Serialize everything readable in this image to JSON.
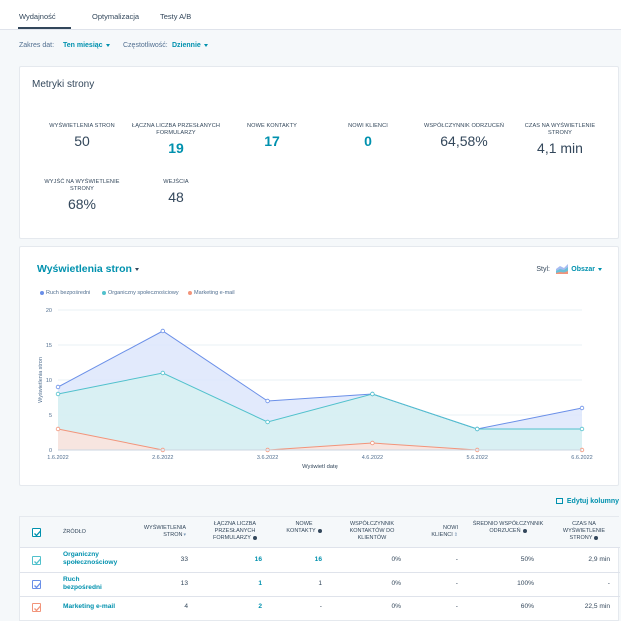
{
  "tabs": [
    {
      "label": "Wydajność",
      "active": true
    },
    {
      "label": "Optymalizacja",
      "active": false
    },
    {
      "label": "Testy A/B",
      "active": false
    }
  ],
  "filters": {
    "date_range_label": "Zakres dat:",
    "date_range_value": "Ten miesiąc",
    "frequency_label": "Częstotliwość:",
    "frequency_value": "Dziennie"
  },
  "metrics": {
    "title": "Metryki strony",
    "items": [
      {
        "label": "WYŚWIETLENIA STRON",
        "value": "50",
        "link": false
      },
      {
        "label": "ŁĄCZNA LICZBA PRZESŁANYCH FORMULARZY",
        "value": "19",
        "link": true
      },
      {
        "label": "NOWE KONTAKTY",
        "value": "17",
        "link": true
      },
      {
        "label": "NOWI KLIENCI",
        "value": "0",
        "link": true
      },
      {
        "label": "WSPÓŁCZYNNIK ODRZUCEŃ",
        "value": "64,58%",
        "link": false
      },
      {
        "label": "CZAS NA WYŚWIETLENIE STRONY",
        "value": "4,1 min",
        "link": false
      },
      {
        "label": "WYJŚĆ NA WYŚWIETLENIE STRONY",
        "value": "68%",
        "link": false
      },
      {
        "label": "WEJŚCIA",
        "value": "48",
        "link": false
      }
    ]
  },
  "chart_header": {
    "title": "Wyświetlenia stron",
    "style_label": "Styl:",
    "style_value": "Obszar"
  },
  "chart_data": {
    "type": "area",
    "x": [
      "1.6.2022",
      "2.6.2022",
      "3.6.2022",
      "4.6.2022",
      "5.6.2022",
      "6.6.2022"
    ],
    "series": [
      {
        "name": "Ruch bezpośredni",
        "color": "#6a8fe8",
        "fill": "#dde6fb",
        "values": [
          9,
          17,
          7,
          8,
          3,
          6
        ]
      },
      {
        "name": "Organiczny społecznościowy",
        "color": "#51c1cc",
        "fill": "#d7f1f1",
        "values": [
          8,
          11,
          4,
          8,
          3,
          3
        ]
      },
      {
        "name": "Marketing e-mail",
        "color": "#f2947a",
        "fill": "#fbe3dc",
        "values": [
          3,
          0,
          0,
          1,
          0,
          0
        ]
      }
    ],
    "ylabel": "Wyświetlenia stron",
    "xlabel": "Wyświetl datę",
    "ylim": [
      0,
      20
    ],
    "yticks": [
      0,
      5,
      10,
      15,
      20
    ],
    "grid": true,
    "legend": "top-left"
  },
  "table": {
    "edit_columns": "Edytuj kolumny",
    "headers": [
      "ŹRÓDŁO",
      "WYŚWIETLENIA STRON",
      "ŁĄCZNA LICZBA PRZESŁANYCH FORMULARZY",
      "NOWE KONTAKTY",
      "WSPÓŁCZYNNIK KONTAKTÓW DO KLIENTÓW",
      "NOWI KLIENCI",
      "ŚREDNIO WSPÓŁCZYNNIK ODRZUCEŃ",
      "CZAS NA WYŚWIETLENIE STRONY"
    ],
    "rows": [
      {
        "source": "Organiczny społecznościowy",
        "views": "33",
        "forms": "16",
        "contacts": "16",
        "rate": "0%",
        "customers": "-",
        "bounce": "50%",
        "time": "2,9 min",
        "color": "#51c1cc"
      },
      {
        "source": "Ruch bezpośredni",
        "views": "13",
        "forms": "1",
        "contacts": "1",
        "rate": "0%",
        "customers": "-",
        "bounce": "100%",
        "time": "-",
        "color": "#6a8fe8"
      },
      {
        "source": "Marketing e-mail",
        "views": "4",
        "forms": "2",
        "contacts": "-",
        "rate": "0%",
        "customers": "-",
        "bounce": "60%",
        "time": "22,5 min",
        "color": "#f2947a"
      }
    ]
  }
}
